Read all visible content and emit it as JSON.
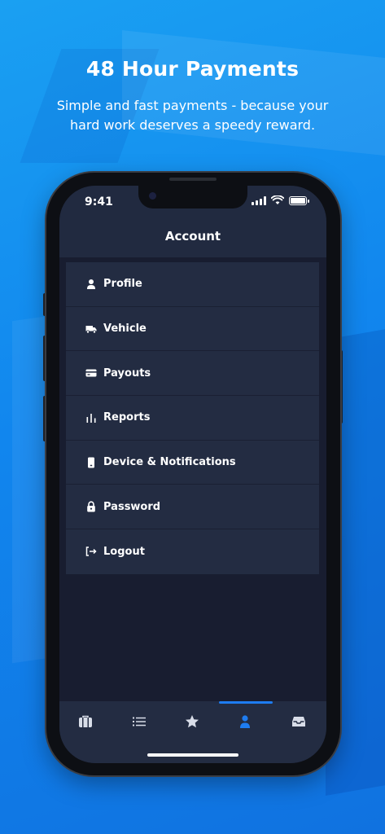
{
  "hero": {
    "title": "48 Hour Payments",
    "subtitle": "Simple and fast payments - because your hard work deserves a speedy reward."
  },
  "status_bar": {
    "time": "9:41",
    "icons": [
      "cellular-signal-icon",
      "wifi-icon",
      "battery-icon"
    ]
  },
  "screen": {
    "title": "Account"
  },
  "menu": {
    "items": [
      {
        "label": "Profile",
        "icon": "person-icon"
      },
      {
        "label": "Vehicle",
        "icon": "truck-icon"
      },
      {
        "label": "Payouts",
        "icon": "credit-card-icon"
      },
      {
        "label": "Reports",
        "icon": "bar-chart-icon"
      },
      {
        "label": "Device & Notifications",
        "icon": "mobile-device-icon"
      },
      {
        "label": "Password",
        "icon": "lock-icon"
      },
      {
        "label": "Logout",
        "icon": "logout-icon"
      }
    ]
  },
  "tab_bar": {
    "tabs": [
      {
        "icon": "briefcase-icon",
        "active": false
      },
      {
        "icon": "list-icon",
        "active": false
      },
      {
        "icon": "star-icon",
        "active": false
      },
      {
        "icon": "person-icon",
        "active": true
      },
      {
        "icon": "inbox-icon",
        "active": false
      }
    ]
  },
  "colors": {
    "background": "#1186ee",
    "screen_background": "#181d30",
    "panel": "#232c42",
    "accent": "#1e7cf0",
    "text": "#ffffff"
  }
}
